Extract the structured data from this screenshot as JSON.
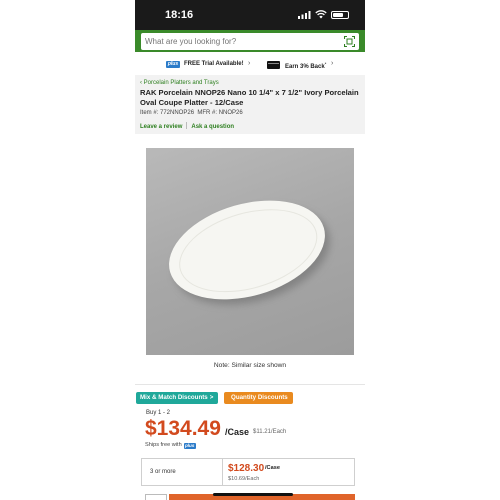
{
  "status_bar": {
    "time": "18:16"
  },
  "search": {
    "placeholder": "What are you looking for?"
  },
  "promo": {
    "plus_badge": "plus",
    "free_trial": "FREE Trial Available!",
    "cashback": "Earn 3% Back",
    "cashback_mark": "*"
  },
  "product": {
    "breadcrumb": "Porcelain Platters and Trays",
    "breadcrumb_chevron": "‹",
    "title": "RAK Porcelain NNOP26 Nano 10 1/4\" x 7 1/2\" Ivory Porcelain Oval Coupe Platter - 12/Case",
    "item_number": "Item #: 772NNOP26",
    "mfr_number": "MFR #: NNOP26",
    "leave_review": "Leave a review",
    "ask_question": "Ask a question",
    "image_note": "Note: Similar size shown"
  },
  "discounts": {
    "mix_match": "Mix & Match Discounts",
    "quantity": "Quantity Discounts",
    "chevron": ">"
  },
  "pricing": {
    "buy_range": "Buy 1 - 2",
    "price": "$134.49",
    "unit": "/Case",
    "each": "$11.21/Each",
    "ships_free": "Ships free with",
    "plus_badge": "plus",
    "tiers": [
      {
        "qty": "3 or more",
        "price": "$128.30",
        "unit": "/Case",
        "each": "$10.69/Each"
      }
    ]
  },
  "colors": {
    "brand_green": "#3a8a2a",
    "price_orange": "#d24a1e",
    "mix_teal": "#1fa89a",
    "qty_orange": "#e98a1f",
    "plus_blue": "#2b7bc9"
  }
}
